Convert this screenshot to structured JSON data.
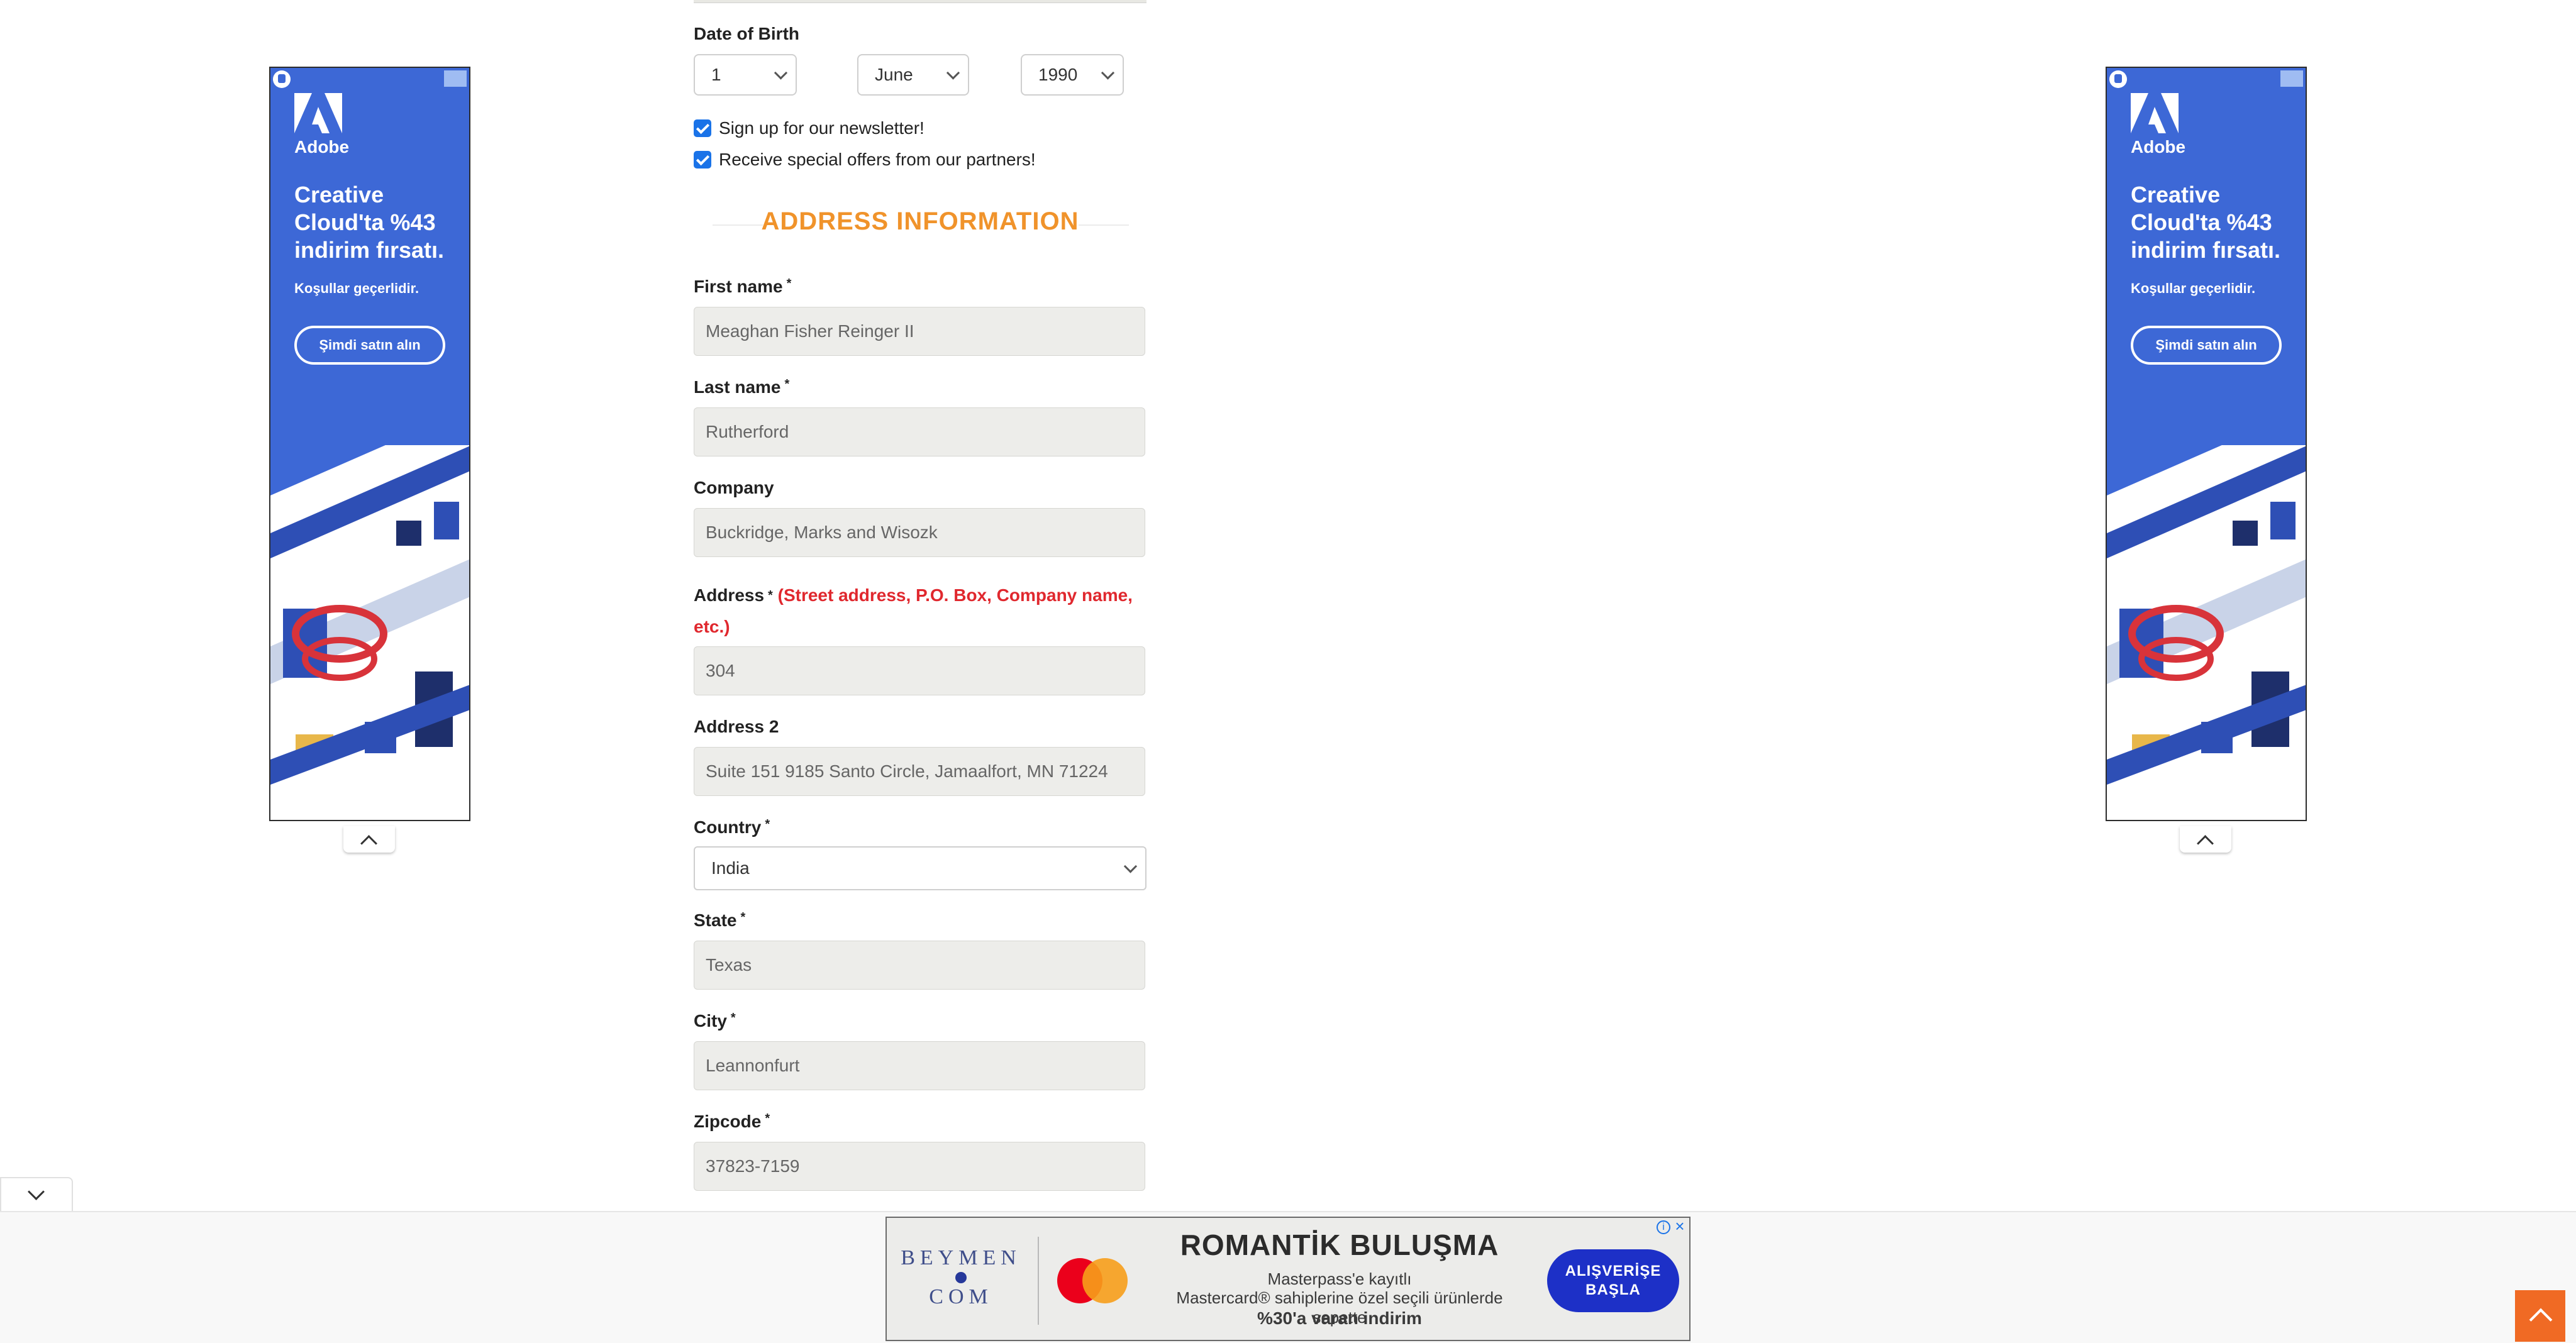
{
  "form": {
    "dob": {
      "label": "Date of Birth",
      "day": "1",
      "month": "June",
      "year": "1990"
    },
    "newsletter": {
      "label": "Sign up for our newsletter!",
      "checked": true
    },
    "partners": {
      "label": "Receive special offers from our partners!",
      "checked": true
    },
    "section_title": "ADDRESS INFORMATION",
    "first_name": {
      "label": "First name",
      "required": "*",
      "value": "Meaghan Fisher Reinger II"
    },
    "last_name": {
      "label": "Last name",
      "required": "*",
      "value": "Rutherford"
    },
    "company": {
      "label": "Company",
      "value": "Buckridge, Marks and Wisozk"
    },
    "address": {
      "label": "Address",
      "required": "*",
      "note_line1": "(Street address, P.O. Box, Company name,",
      "note_line2": "etc.)",
      "value": "304"
    },
    "address2": {
      "label": "Address 2",
      "value": "Suite 151 9185 Santo Circle, Jamaalfort, MN 71224"
    },
    "country": {
      "label": "Country",
      "required": "*",
      "value": "India"
    },
    "state": {
      "label": "State",
      "required": "*",
      "value": "Texas"
    },
    "city": {
      "label": "City",
      "required": "*",
      "value": "Leannonfurt"
    },
    "zipcode": {
      "label": "Zipcode",
      "required": "*",
      "value": "37823-7159"
    }
  },
  "side_ad": {
    "brand": "Adobe",
    "headline": "Creative Cloud'ta %43 indirim fırsatı.",
    "sub": "Koşullar geçerlidir.",
    "cta": "Şimdi satın alın",
    "colors": {
      "background": "#3d68d6",
      "text": "#ffffff"
    }
  },
  "bottom_ad": {
    "brand_line1": "BEYMEN",
    "brand_line2": "COM",
    "headline": "ROMANTİK BULUŞMA",
    "line1": "Masterpass'e kayıtlı",
    "line2": "Mastercard® sahiplerine özel seçili ürünlerde sepette",
    "line3": "%30'a varan indirim",
    "cta_line1": "ALIŞVERİŞE",
    "cta_line2": "BAŞLA",
    "info_icon": "info-icon",
    "close_icon": "close-icon",
    "colors": {
      "cta": "#1d30c7",
      "brand": "#3f4e8a"
    }
  },
  "colors": {
    "section_title": "#f0932b",
    "required_note": "#e0282e",
    "checkbox": "#1a73e8",
    "scroll_top": "#f06a24",
    "input_bg": "#ededea"
  }
}
